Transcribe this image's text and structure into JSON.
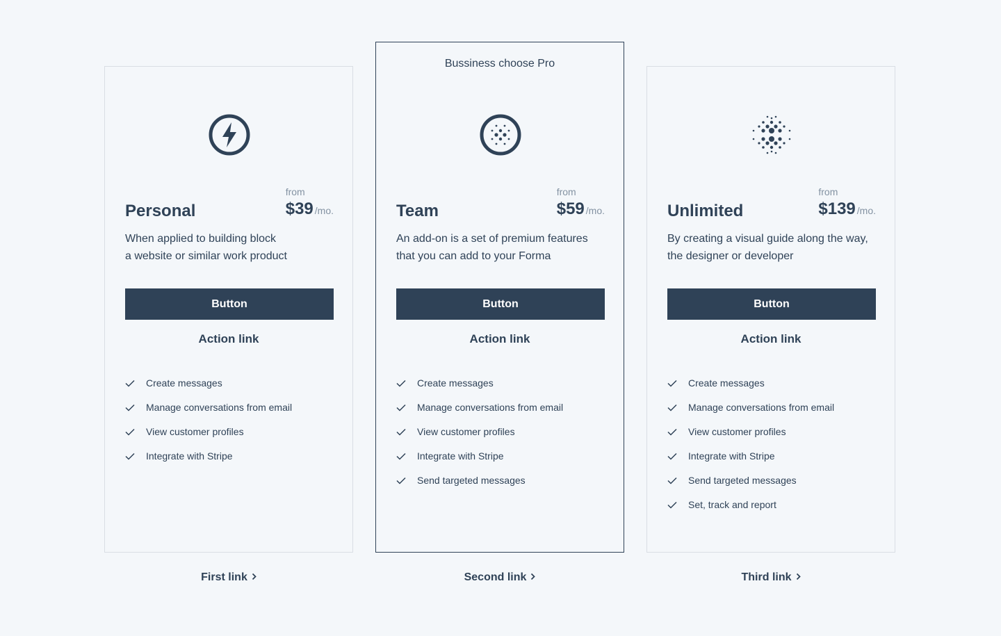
{
  "colors": {
    "background": "#f4f7fa",
    "primary": "#2f4257",
    "muted": "#8392a2",
    "border": "#d9dee4"
  },
  "plans": [
    {
      "icon": "lightning-icon",
      "name": "Personal",
      "from_label": "from",
      "price": "$39",
      "period": "/mo.",
      "description": [
        "When applied to building block",
        "a website or similar work product"
      ],
      "button_label": "Button",
      "action_link": "Action link",
      "features": [
        "Create messages",
        "Manage conversations from email",
        "View customer profiles",
        "Integrate with Stripe"
      ],
      "bottom_link": "First link"
    },
    {
      "badge": "Bussiness choose Pro",
      "icon": "dotted-globe-icon",
      "name": "Team",
      "from_label": "from",
      "price": "$59",
      "period": "/mo.",
      "description": [
        "An add-on is a set of premium features",
        "that you can add to your Forma"
      ],
      "button_label": "Button",
      "action_link": "Action link",
      "features": [
        "Create messages",
        "Manage conversations from email",
        "View customer profiles",
        "Integrate with Stripe",
        "Send targeted messages"
      ],
      "bottom_link": "Second link"
    },
    {
      "icon": "dot-sphere-icon",
      "name": "Unlimited",
      "from_label": "from",
      "price": "$139",
      "period": "/mo.",
      "description": [
        "By creating a visual guide along the way,",
        "the designer or developer"
      ],
      "button_label": "Button",
      "action_link": "Action link",
      "features": [
        "Create messages",
        "Manage conversations from email",
        "View customer profiles",
        "Integrate with Stripe",
        "Send targeted messages",
        "Set, track and report"
      ],
      "bottom_link": "Third link"
    }
  ]
}
